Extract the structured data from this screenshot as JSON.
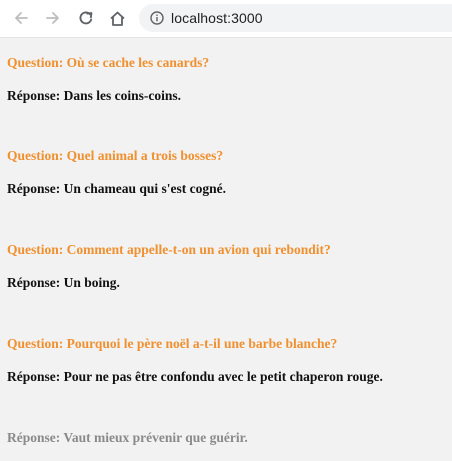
{
  "browser": {
    "url": "localhost:3000",
    "icons": [
      "back-arrow-icon",
      "forward-arrow-icon",
      "reload-icon",
      "home-icon",
      "info-icon"
    ]
  },
  "qa": [
    {
      "question": "Question: Où se cache les canards?",
      "answer": "Réponse: Dans les coins-coins."
    },
    {
      "question": "Question: Quel animal a trois bosses?",
      "answer": "Réponse: Un chameau qui s'est cogné."
    },
    {
      "question": "Question: Comment appelle-t-on un avion qui rebondit?",
      "answer": "Réponse: Un boing."
    },
    {
      "question": "Question: Pourquoi le père noël a-t-il une barbe blanche?",
      "answer": "Réponse: Pour ne pas être confondu avec le petit chaperon rouge."
    }
  ],
  "final_answer": "Réponse: Vaut mieux prévenir que guérir.",
  "colors": {
    "question": "#f0902f",
    "answer": "#111111",
    "final_answer": "#8a8a8a"
  }
}
